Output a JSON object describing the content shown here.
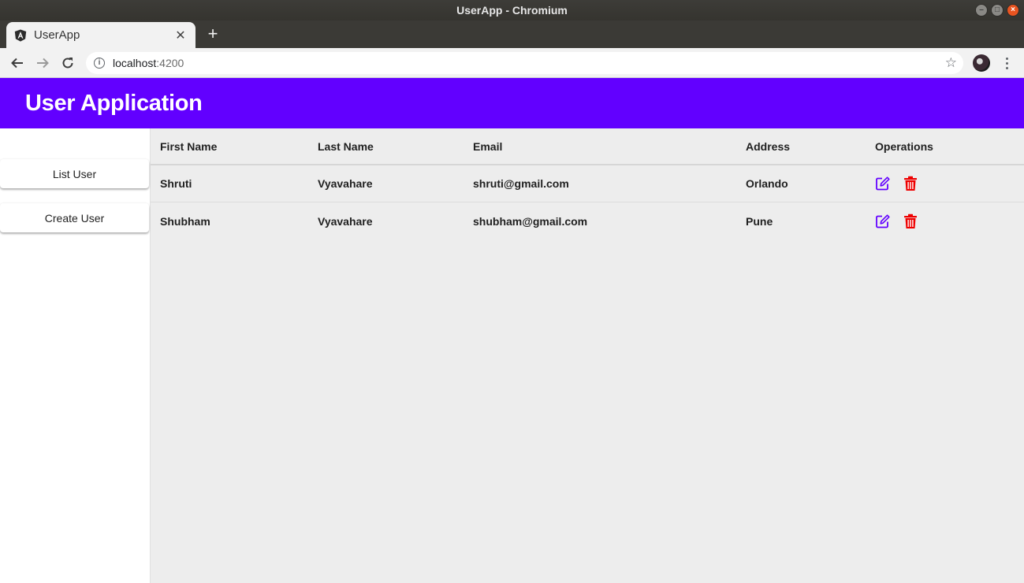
{
  "window": {
    "title": "UserApp - Chromium"
  },
  "browser": {
    "tab_title": "UserApp",
    "url_host": "localhost",
    "url_port": ":4200"
  },
  "app": {
    "title": "User Application",
    "accent_color": "#6200ff"
  },
  "sidebar": {
    "items": [
      {
        "label": "List User"
      },
      {
        "label": "Create User"
      }
    ]
  },
  "table": {
    "columns": [
      "First Name",
      "Last Name",
      "Email",
      "Address",
      "Operations"
    ],
    "rows": [
      {
        "first_name": "Shruti",
        "last_name": "Vyavahare",
        "email": "shruti@gmail.com",
        "address": "Orlando"
      },
      {
        "first_name": "Shubham",
        "last_name": "Vyavahare",
        "email": "shubham@gmail.com",
        "address": "Pune"
      }
    ],
    "operations": [
      {
        "icon": "edit-icon",
        "color": "#6200ff"
      },
      {
        "icon": "delete-icon",
        "color": "#ee0000"
      }
    ]
  }
}
